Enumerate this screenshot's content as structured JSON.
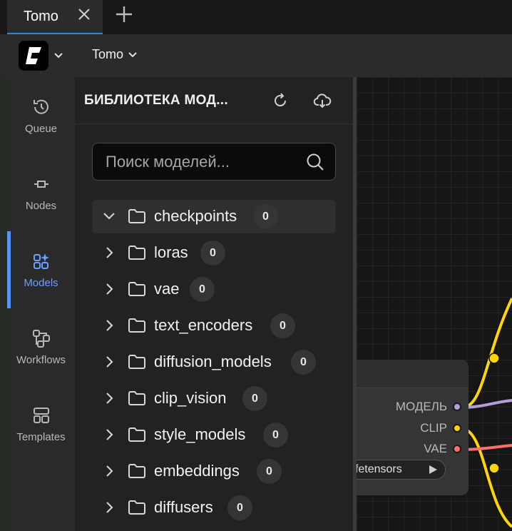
{
  "tabs": [
    {
      "label": "Tomo"
    }
  ],
  "toolbar": {
    "workspace_label": "Tomo"
  },
  "rail": {
    "items": [
      {
        "label": "Queue",
        "icon": "history-icon"
      },
      {
        "label": "Nodes",
        "icon": "node-icon"
      },
      {
        "label": "Models",
        "icon": "models-icon"
      },
      {
        "label": "Workflows",
        "icon": "workflow-icon"
      },
      {
        "label": "Templates",
        "icon": "templates-icon"
      }
    ],
    "active": "Models"
  },
  "panel": {
    "title": "БИБЛИОТЕКА МОД...",
    "search": {
      "placeholder": "Поиск моделей...",
      "value": ""
    },
    "folders": [
      {
        "label": "checkpoints",
        "count": "0",
        "expanded": true
      },
      {
        "label": "loras",
        "count": "0",
        "expanded": false
      },
      {
        "label": "vae",
        "count": "0",
        "expanded": false
      },
      {
        "label": "text_encoders",
        "count": "0",
        "expanded": false
      },
      {
        "label": "diffusion_models",
        "count": "0",
        "expanded": false
      },
      {
        "label": "clip_vision",
        "count": "0",
        "expanded": false
      },
      {
        "label": "style_models",
        "count": "0",
        "expanded": false
      },
      {
        "label": "embeddings",
        "count": "0",
        "expanded": false
      },
      {
        "label": "diffusers",
        "count": "0",
        "expanded": false
      }
    ]
  },
  "canvas": {
    "node": {
      "outputs": [
        {
          "label": "МОДЕЛЬ",
          "color": "#b39ddb"
        },
        {
          "label": "CLIP",
          "color": "#ffd500"
        },
        {
          "label": "VAE",
          "color": "#ff6e6e"
        }
      ],
      "ckpt_value": "afetensors"
    }
  },
  "colors": {
    "accent": "#5b93f5",
    "wire_clip": "#ffd500",
    "wire_model": "#b39ddb",
    "wire_vae": "#ff6e6e"
  }
}
